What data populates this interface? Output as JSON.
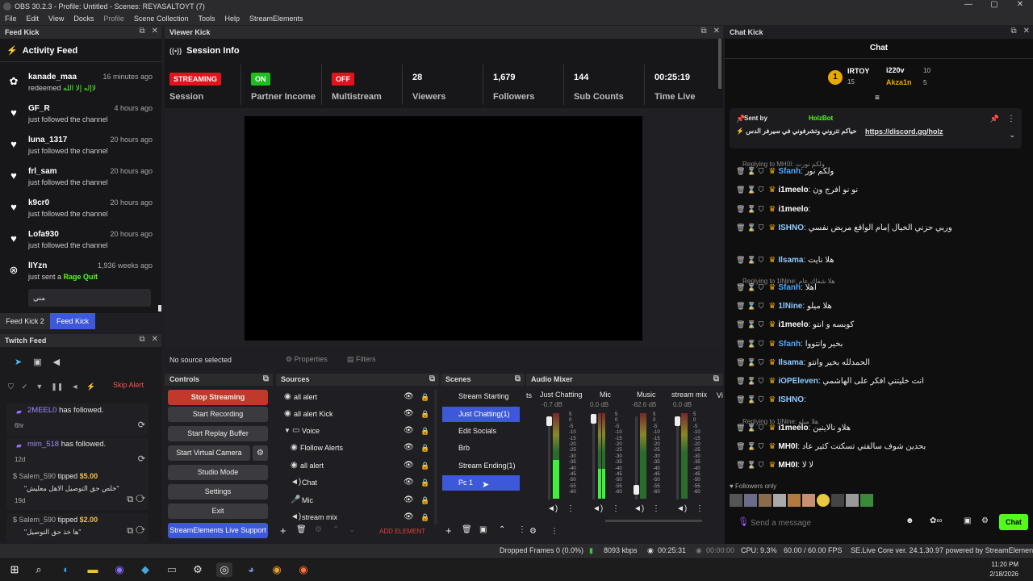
{
  "titlebar": {
    "title": "OBS 30.2.3 - Profile: Untitled - Scenes: REYASALTOYT (7)",
    "min": "—",
    "max": "▢",
    "close": "✕"
  },
  "menu": [
    "File",
    "Edit",
    "View",
    "Docks",
    "Profile",
    "Scene Collection",
    "Tools",
    "Help",
    "StreamElements"
  ],
  "feed_kick": {
    "title": "Feed Kick",
    "activity_title": "Activity Feed",
    "items": [
      {
        "name": "kanade_maa",
        "time": "16 minutes ago",
        "desc": "redeemed",
        "extra": "لاإله إلا الله",
        "icon": "gift"
      },
      {
        "name": "GF_R",
        "time": "4 hours ago",
        "desc": "just followed the channel",
        "icon": "heart"
      },
      {
        "name": "luna_1317",
        "time": "20 hours ago",
        "desc": "just followed the channel",
        "icon": "heart"
      },
      {
        "name": "frl_sam",
        "time": "20 hours ago",
        "desc": "just followed the channel",
        "icon": "heart"
      },
      {
        "name": "k9cr0",
        "time": "20 hours ago",
        "desc": "just followed the channel",
        "icon": "heart"
      },
      {
        "name": "Lofa930",
        "time": "20 hours ago",
        "desc": "just followed the channel",
        "icon": "heart"
      },
      {
        "name": "lIYzn",
        "time": "1,936 weeks ago",
        "desc": "just sent a",
        "extra": "Rage Quit",
        "icon": "x"
      }
    ],
    "message": "مني",
    "tabs": [
      "Feed Kick 2",
      "Feed Kick"
    ]
  },
  "twitch_feed": {
    "title": "Twitch Feed",
    "skip_alert": "Skip Alert",
    "items": [
      {
        "name": "2MEEL0",
        "text": "has followed.",
        "time": "6hr"
      },
      {
        "name": "mim_518",
        "text": "has followed.",
        "time": "12d"
      },
      {
        "name": "Salem_590",
        "text": "tipped",
        "amount": "$5.00",
        "msg": "\"خلص حق التوصيل الاهل معليش\"",
        "time": "19d"
      },
      {
        "name": "Salem_590",
        "text": "tipped",
        "amount": "$2.00",
        "msg": "\"ها خذ حق التوصيل\""
      }
    ]
  },
  "viewer_kick": {
    "title": "Viewer Kick",
    "session_title": "Session Info",
    "stats": [
      {
        "value": "STREAMING",
        "label": "Session",
        "color": "#e3121b"
      },
      {
        "value": "ON",
        "label": "Partner Income",
        "color": "#1dbf1d"
      },
      {
        "value": "OFF",
        "label": "Multistream",
        "color": "#e3121b"
      },
      {
        "value": "28",
        "label": "Viewers"
      },
      {
        "value": "1,679",
        "label": "Followers"
      },
      {
        "value": "144",
        "label": "Sub Counts"
      },
      {
        "value": "00:25:19",
        "label": "Time Live"
      }
    ],
    "no_source": "No source selected",
    "properties": "Properties",
    "filters": "Filters"
  },
  "controls": {
    "title": "Controls",
    "buttons": [
      "Stop Streaming",
      "Start Recording",
      "Start Replay Buffer",
      "Start Virtual Camera",
      "Studio Mode",
      "Settings",
      "Exit",
      "StreamElements Live Support"
    ]
  },
  "sources": {
    "title": "Sources",
    "items": [
      "all alert",
      "all alert Kick",
      "Voice",
      "Flollow Alerts",
      "all alert",
      "Chat",
      "Mic",
      "stream mix"
    ],
    "add_element": "ADD ELEMENT"
  },
  "scenes": {
    "title": "Scenes",
    "items": [
      "Stream Starting",
      "Just Chatting(1)",
      "Edit Socials",
      "Brb",
      "Stream Ending(1)",
      "Pc 1"
    ]
  },
  "audio_mixer": {
    "title": "Audio Mixer",
    "channels": [
      {
        "name": "Just Chatting",
        "db": "-0.7 dB",
        "level": 0.45
      },
      {
        "name": "Mic",
        "db": "0.0 dB",
        "level": 0.35
      },
      {
        "name": "Music",
        "db": "-82.6 dB",
        "level": 0.0
      },
      {
        "name": "stream mix",
        "db": "0.0 dB",
        "level": 0.0
      }
    ],
    "ts": "ts",
    "vi": "Vi",
    "scale": [
      "5",
      "0",
      "-5",
      "-10",
      "-15",
      "-20",
      "-25",
      "-30",
      "-35",
      "-40",
      "-45",
      "-50",
      "-55",
      "-60"
    ]
  },
  "chat_kick": {
    "title": "Chat Kick",
    "header": "Chat",
    "top": {
      "u1": "IRTOY",
      "n1": "15",
      "u2": "i220v",
      "n2": "10",
      "u3": "Akza1n",
      "n3": "5",
      "rank": "1"
    },
    "pinned": {
      "sent_by": "Sent by",
      "user": "HolzBot",
      "text": "⚡ حياكم تتروني وتشرفوني في سيرفر الدس",
      "link": "https://discord.gg/holz"
    },
    "lines": [
      {
        "reply": "Replying to MH0I: ولكم نورت"
      },
      {
        "user": "Sfanh",
        "color": "#4aa8ff",
        "msg": "ولكم نور"
      },
      {
        "user": "i1meelo",
        "color": "#ffffff",
        "msg": "نو نو افرج ون"
      },
      {
        "user": "i1meelo",
        "color": "#ffffff",
        "msg": ""
      },
      {
        "user": "ISHNO",
        "color": "#8ecbff",
        "msg": "وربي حزني الخيال إمام الواقع مريض نفسي"
      },
      {
        "user": "Ilsama",
        "color": "#8ecbff",
        "msg": "هلا نايت"
      },
      {
        "reply": "Replying to 1lNine: هلا شفاك عام"
      },
      {
        "user": "Sfanh",
        "color": "#4aa8ff",
        "msg": "اهلا"
      },
      {
        "user": "1lNine",
        "color": "#8ecbff",
        "msg": "هلا ميلو"
      },
      {
        "user": "i1meelo",
        "color": "#ffffff",
        "msg": "كوبسه و انتو"
      },
      {
        "user": "Sfanh",
        "color": "#4aa8ff",
        "msg": "بخير وانتووا"
      },
      {
        "user": "Ilsama",
        "color": "#8ecbff",
        "msg": "الحمدلله بخير وانتو"
      },
      {
        "user": "iOPEleven",
        "color": "#8ecbff",
        "msg": "انت خليتني افكر على الهاشمي"
      },
      {
        "user": "ISHNO",
        "color": "#8ecbff",
        "msg": ""
      },
      {
        "reply": "Replying to 1lNine: هلا ميلو"
      },
      {
        "user": "i1meelo",
        "color": "#ffffff",
        "msg": "هلاو نالاينين"
      },
      {
        "user": "MH0I",
        "color": "#ffffff",
        "msg": "بحدين شوف سالفتي تسكتت كثير عاد"
      },
      {
        "user": "MH0I",
        "color": "#ffffff",
        "msg": "لا لا"
      }
    ],
    "followers_only": "Followers only",
    "placeholder": "Send a message",
    "chat_btn": "Chat"
  },
  "status": {
    "dropped": "Dropped Frames 0 (0.0%)",
    "kbps": "8093 kbps",
    "live": "00:25:31",
    "rec": "00:00:00",
    "cpu": "CPU: 9.3%",
    "fps": "60.00 / 60.00 FPS",
    "se": "SE.Live Core ver. 24.1.30.97 powered by StreamElements"
  },
  "taskbar": {
    "time": "11:20 PM",
    "date": "2/18/2026"
  }
}
